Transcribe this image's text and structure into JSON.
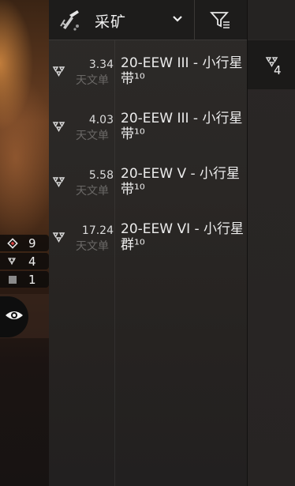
{
  "header": {
    "title": "采矿",
    "category_icon": "mining-laser-icon",
    "dropdown_icon": "chevron-down-icon",
    "filter_icon": "filter-icon"
  },
  "rows": [
    {
      "distance": "3.34",
      "unit": "天文单",
      "name": "20-EEW III - 小行星带¹⁰",
      "icon": "asteroid-belt-icon"
    },
    {
      "distance": "4.03",
      "unit": "天文单",
      "name": "20-EEW III - 小行星带¹⁰",
      "icon": "asteroid-belt-icon"
    },
    {
      "distance": "5.58",
      "unit": "天文单",
      "name": "20-EEW V - 小行星带¹⁰",
      "icon": "asteroid-belt-icon"
    },
    {
      "distance": "17.24",
      "unit": "天文单",
      "name": "20-EEW VI - 小行星群¹⁰",
      "icon": "asteroid-belt-icon"
    }
  ],
  "side_tab": {
    "count": "4",
    "icon": "asteroid-belt-icon"
  },
  "overview_counts": [
    {
      "icon": "hostile-diamond-icon",
      "count": "9"
    },
    {
      "icon": "asteroid-belt-icon",
      "count": "4"
    },
    {
      "icon": "structure-square-icon",
      "count": "1"
    }
  ],
  "colors": {
    "accent": "#e6e6e6",
    "panel_bg": "#2a2725",
    "header_bg": "#1d1c1b",
    "muted_text": "#6a6866"
  }
}
